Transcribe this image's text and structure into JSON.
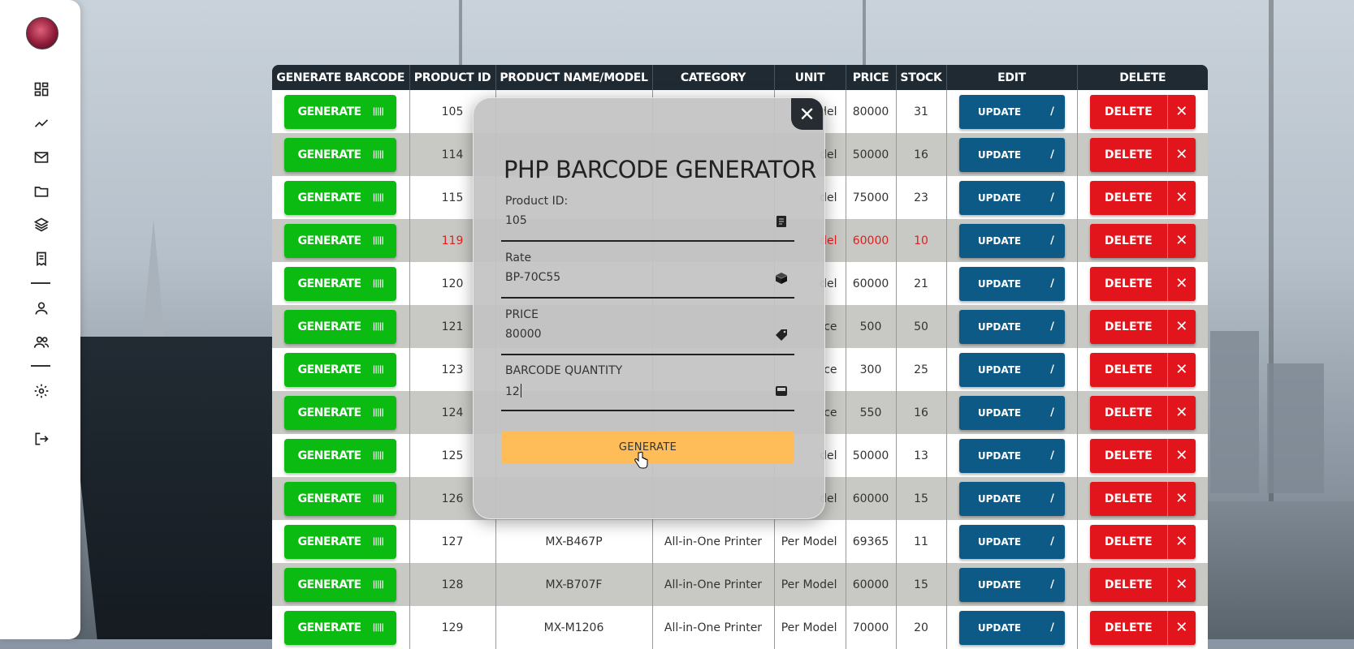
{
  "table": {
    "headers": [
      "GENERATE BARCODE",
      "PRODUCT ID",
      "PRODUCT NAME/MODEL",
      "CATEGORY",
      "UNIT",
      "PRICE",
      "STOCK",
      "EDIT",
      "DELETE"
    ],
    "generate_label": "GENERATE",
    "barcode_glyph": "|||||",
    "update_label": "UPDATE",
    "delete_label": "DELETE",
    "rows": [
      {
        "id": "105",
        "name": "",
        "category": "",
        "unit": "del",
        "price": "80000",
        "stock": "31",
        "alert": false
      },
      {
        "id": "114",
        "name": "",
        "category": "",
        "unit": "del",
        "price": "50000",
        "stock": "16",
        "alert": false
      },
      {
        "id": "115",
        "name": "",
        "category": "",
        "unit": "del",
        "price": "75000",
        "stock": "23",
        "alert": false
      },
      {
        "id": "119",
        "name": "",
        "category": "",
        "unit": "del",
        "price": "60000",
        "stock": "10",
        "alert": true
      },
      {
        "id": "120",
        "name": "",
        "category": "",
        "unit": "del",
        "price": "60000",
        "stock": "21",
        "alert": false
      },
      {
        "id": "121",
        "name": "",
        "category": "",
        "unit": "ce",
        "price": "500",
        "stock": "50",
        "alert": false
      },
      {
        "id": "123",
        "name": "",
        "category": "",
        "unit": "ce",
        "price": "300",
        "stock": "25",
        "alert": false
      },
      {
        "id": "124",
        "name": "",
        "category": "",
        "unit": "ce",
        "price": "550",
        "stock": "16",
        "alert": false
      },
      {
        "id": "125",
        "name": "",
        "category": "",
        "unit": "del",
        "price": "50000",
        "stock": "13",
        "alert": false
      },
      {
        "id": "126",
        "name": "",
        "category": "",
        "unit": "del",
        "price": "60000",
        "stock": "15",
        "alert": false
      },
      {
        "id": "127",
        "name": "MX-B467P",
        "category": "All-in-One Printer",
        "unit": "Per Model",
        "price": "69365",
        "stock": "11",
        "alert": false
      },
      {
        "id": "128",
        "name": "MX-B707F",
        "category": "All-in-One Printer",
        "unit": "Per Model",
        "price": "60000",
        "stock": "15",
        "alert": false
      },
      {
        "id": "129",
        "name": "MX-M1206",
        "category": "All-in-One Printer",
        "unit": "Per Model",
        "price": "70000",
        "stock": "20",
        "alert": false
      }
    ]
  },
  "modal": {
    "title": "PHP BARCODE GENERATOR",
    "close_glyph": "✕",
    "fields": [
      {
        "label": "Product ID:",
        "value": "105",
        "icon": "document-icon"
      },
      {
        "label": "Rate",
        "value": "BP-70C55",
        "icon": "cube-icon"
      },
      {
        "label": "PRICE",
        "value": "80000",
        "icon": "tag-icon"
      },
      {
        "label": "BARCODE QUANTITY",
        "value": "12",
        "icon": "inbox-icon"
      }
    ],
    "submit_label": "GENERATE"
  },
  "sidebar": {
    "icons": [
      "dashboard-icon",
      "chart-line-icon",
      "mail-icon",
      "folder-icon",
      "layers-icon",
      "receipt-icon",
      "user-icon",
      "users-icon",
      "settings-icon",
      "logout-icon"
    ]
  },
  "colors": {
    "generate_green": "#0cbb12",
    "update_blue": "#0c5a85",
    "delete_red": "#e3151c",
    "submit_orange": "#ffbd59",
    "header_dark": "#1f2a32",
    "alert_red": "#e02020"
  }
}
